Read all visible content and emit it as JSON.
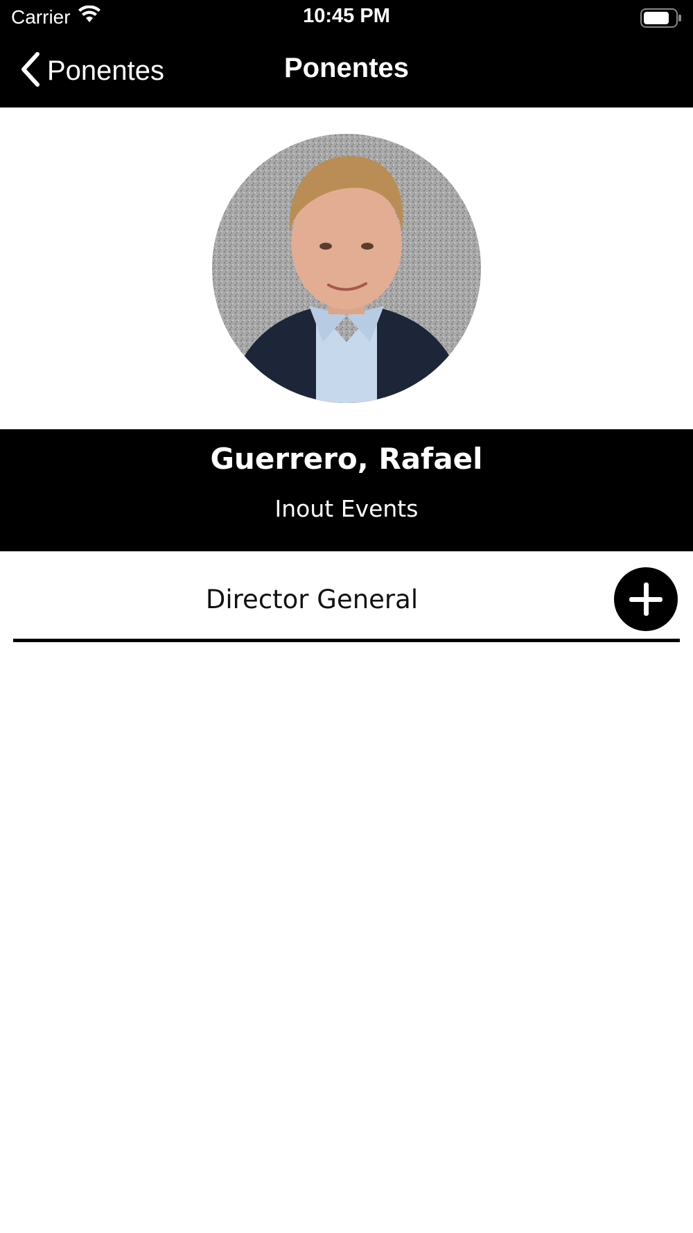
{
  "status_bar": {
    "carrier": "Carrier",
    "time": "10:45 PM"
  },
  "nav": {
    "back_label": "Ponentes",
    "title": "Ponentes"
  },
  "speaker": {
    "name": "Guerrero, Rafael",
    "company": "Inout Events",
    "role": "Director General"
  },
  "icons": {
    "back": "chevron-left-icon",
    "add": "plus-icon",
    "wifi": "wifi-icon",
    "battery": "battery-icon"
  },
  "colors": {
    "bar_background": "#000000",
    "page_background": "#ffffff",
    "text_on_dark": "#ffffff"
  }
}
